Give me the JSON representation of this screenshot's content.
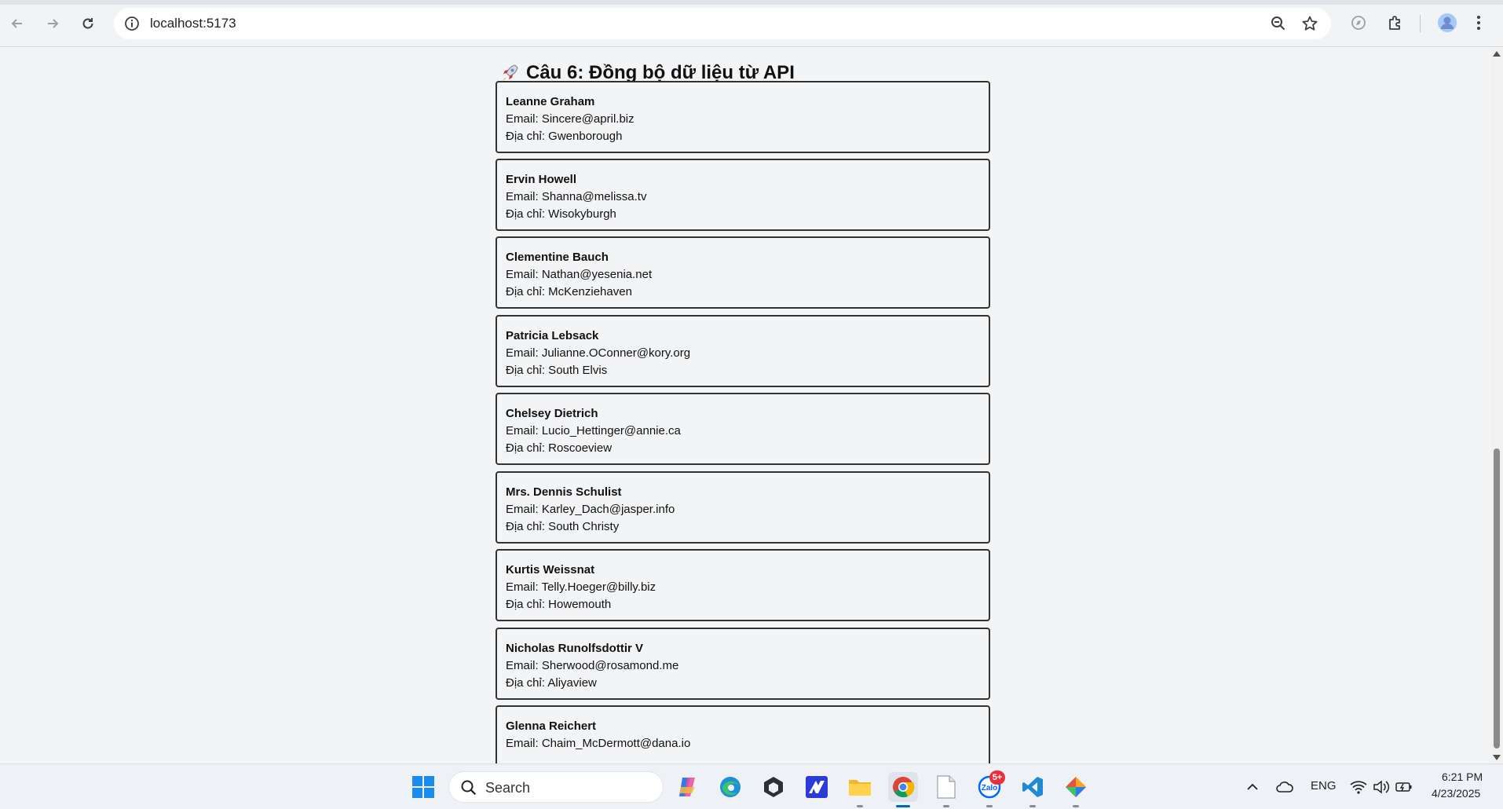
{
  "browser": {
    "url": "localhost:5173"
  },
  "page": {
    "title": "Câu 6: Đồng bộ dữ liệu từ API",
    "users": [
      {
        "name": "Leanne Graham",
        "email": "Email: Sincere@april.biz",
        "address": "Địa chỉ: Gwenborough"
      },
      {
        "name": "Ervin Howell",
        "email": "Email: Shanna@melissa.tv",
        "address": "Địa chỉ: Wisokyburgh"
      },
      {
        "name": "Clementine Bauch",
        "email": "Email: Nathan@yesenia.net",
        "address": "Địa chỉ: McKenziehaven"
      },
      {
        "name": "Patricia Lebsack",
        "email": "Email: Julianne.OConner@kory.org",
        "address": "Địa chỉ: South Elvis"
      },
      {
        "name": "Chelsey Dietrich",
        "email": "Email: Lucio_Hettinger@annie.ca",
        "address": "Địa chỉ: Roscoeview"
      },
      {
        "name": "Mrs. Dennis Schulist",
        "email": "Email: Karley_Dach@jasper.info",
        "address": "Địa chỉ: South Christy"
      },
      {
        "name": "Kurtis Weissnat",
        "email": "Email: Telly.Hoeger@billy.biz",
        "address": "Địa chỉ: Howemouth"
      },
      {
        "name": "Nicholas Runolfsdottir V",
        "email": "Email: Sherwood@rosamond.me",
        "address": "Địa chỉ: Aliyaview"
      },
      {
        "name": "Glenna Reichert",
        "email": "Email: Chaim_McDermott@dana.io",
        "address": ""
      }
    ]
  },
  "taskbar": {
    "search_placeholder": "Search",
    "zalo_badge": "5+",
    "language": "ENG",
    "time": "6:21 PM",
    "date": "4/23/2025"
  },
  "colors": {
    "page_bg": "#f3f4f6",
    "card_border": "#333333",
    "taskbar_bg": "#eef1f6"
  }
}
